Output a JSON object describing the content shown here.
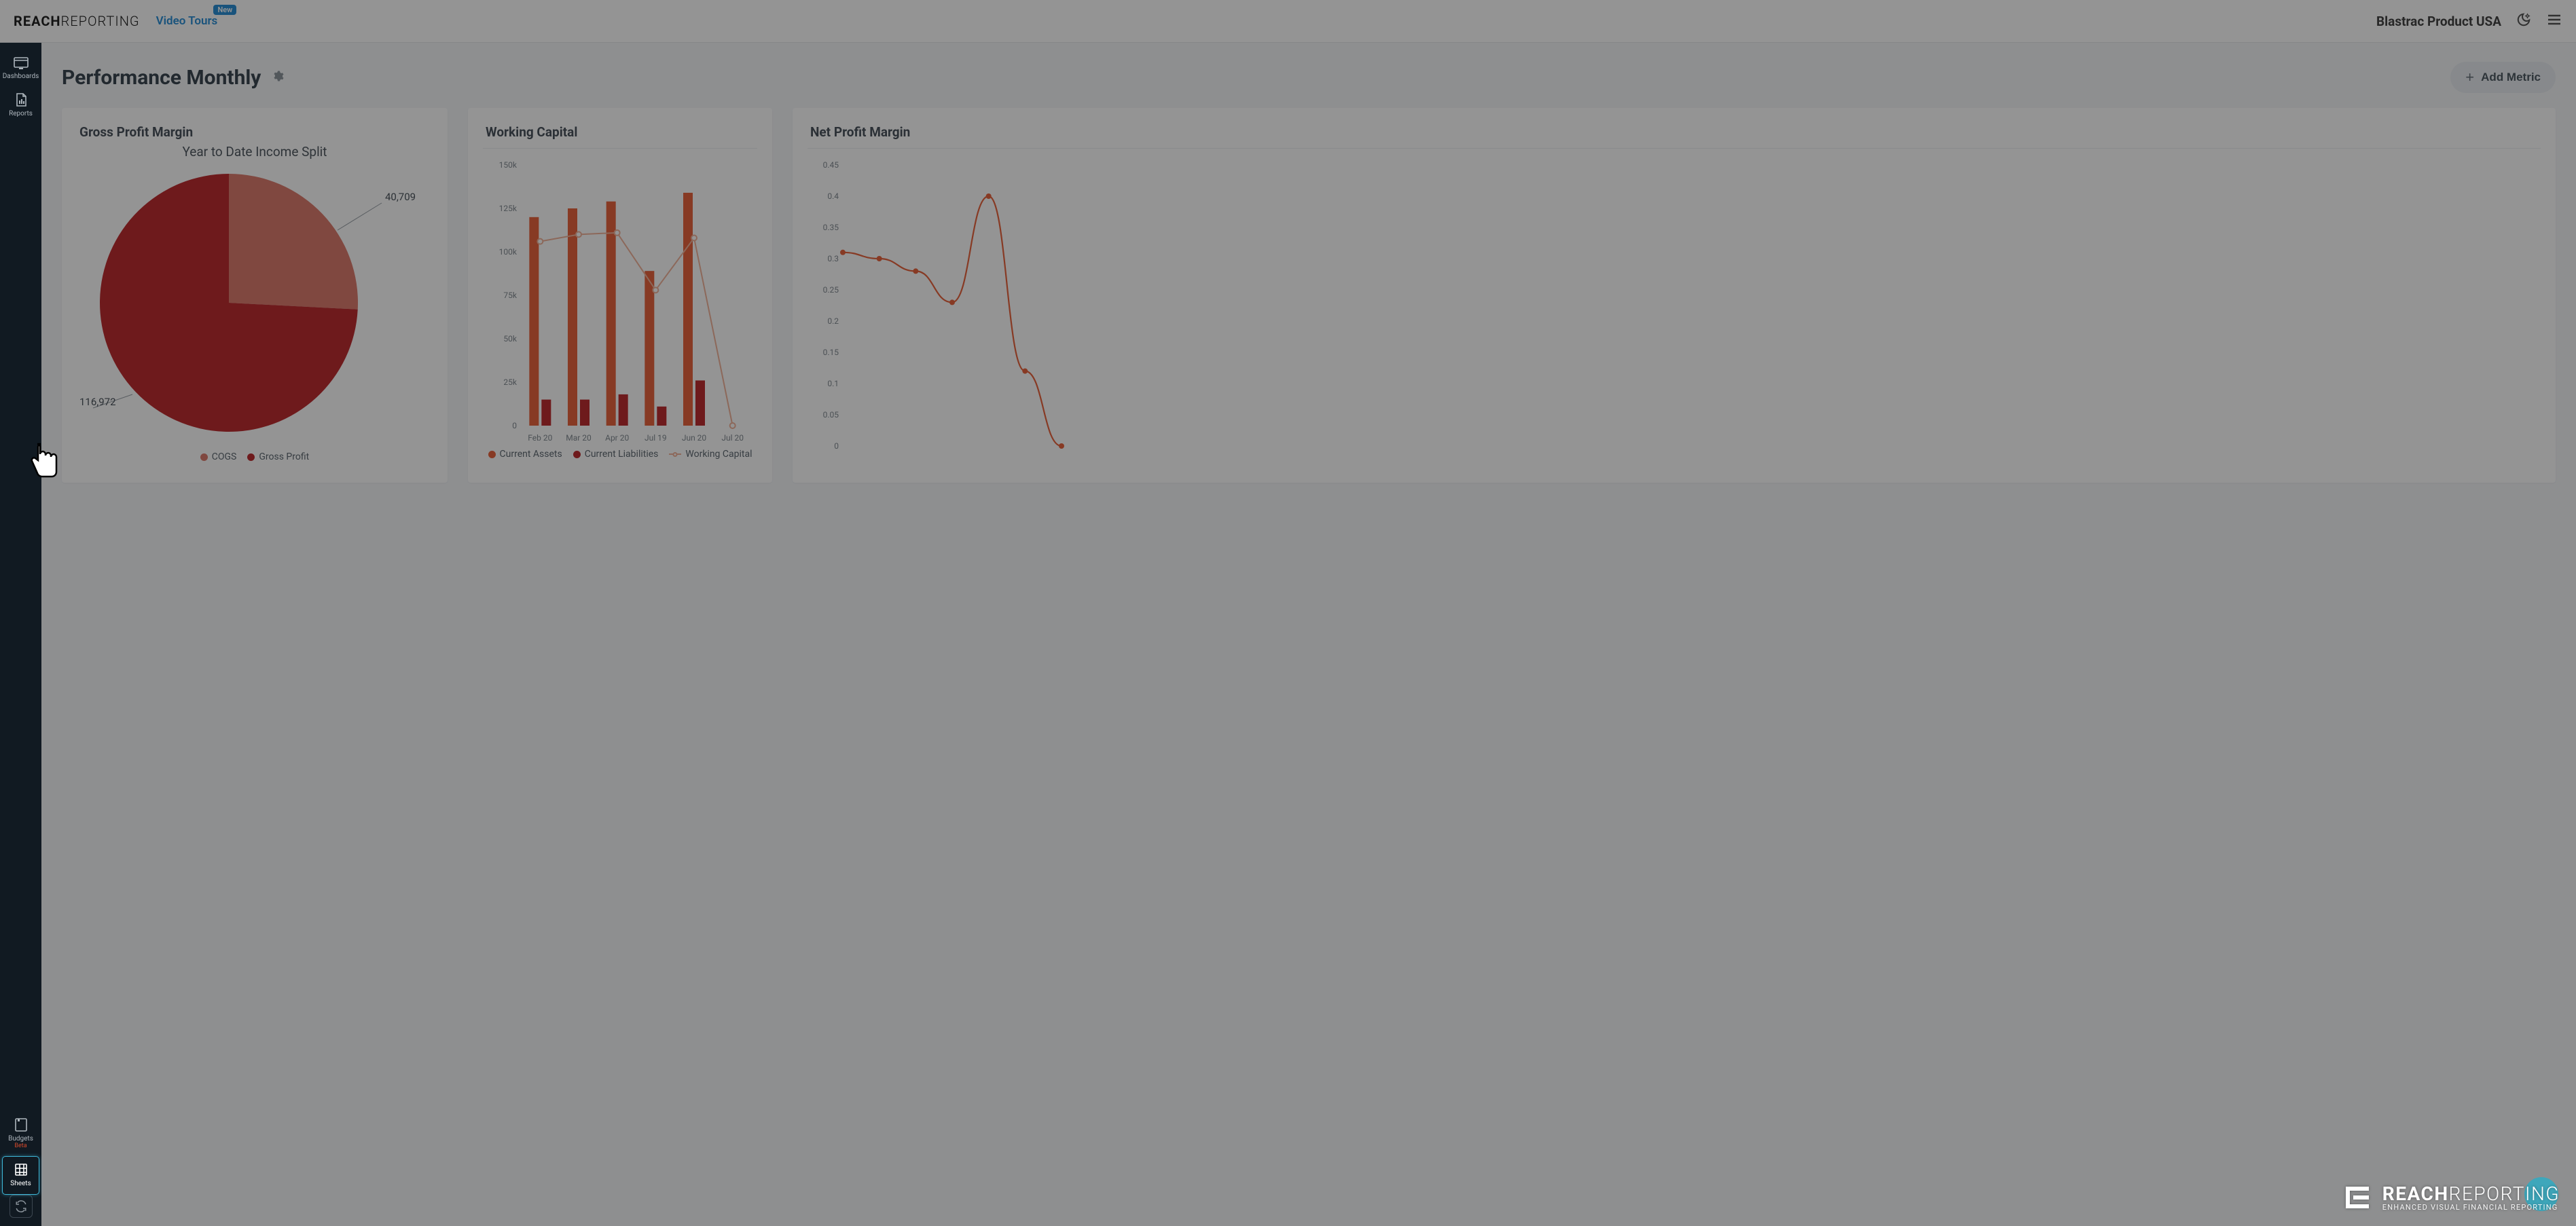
{
  "header": {
    "brand_bold": "REACH",
    "brand_light": "REPORTING",
    "video_tours": "Video Tours",
    "video_tours_badge": "New",
    "company": "Blastrac Product USA"
  },
  "sidebar": {
    "dashboards": "Dashboards",
    "reports": "Reports",
    "budgets": "Budgets",
    "budgets_beta": "Beta",
    "sheets": "Sheets"
  },
  "page": {
    "title": "Performance Monthly",
    "add_metric": "Add Metric"
  },
  "cards": {
    "gross_profit": {
      "title": "Gross Profit Margin",
      "subtitle": "Year to Date Income Split"
    },
    "working_capital": {
      "title": "Working Capital"
    },
    "net_profit": {
      "title": "Net Profit Margin"
    }
  },
  "watermark": {
    "main_bold": "REACH",
    "main_light": "REPORTING",
    "sub": "ENHANCED VISUAL FINANCIAL REPORTING"
  },
  "chart_data": [
    {
      "type": "pie",
      "title": "Year to Date Income Split",
      "series": [
        {
          "name": "COGS",
          "value": 40709,
          "color": "#dc7d6f"
        },
        {
          "name": "Gross Profit",
          "value": 116972,
          "color": "#be2e31"
        }
      ],
      "labels": [
        "40,709",
        "116,972"
      ]
    },
    {
      "type": "bar",
      "title": "Working Capital",
      "categories": [
        "Feb 20",
        "Mar 20",
        "Apr 20",
        "Jul 19",
        "Jun 20",
        "Jul 20"
      ],
      "ylim": [
        0,
        150000
      ],
      "yticks": [
        "0",
        "25k",
        "50k",
        "75k",
        "100k",
        "125k",
        "150k"
      ],
      "series": [
        {
          "name": "Current Assets",
          "color": "#e8653f",
          "values": [
            120000,
            125000,
            129000,
            89000,
            134000,
            0
          ]
        },
        {
          "name": "Current Liabilities",
          "color": "#be2e31",
          "values": [
            15000,
            15000,
            18000,
            11000,
            26000,
            0
          ]
        },
        {
          "name": "Working Capital",
          "type": "line",
          "color": "#f2b49b",
          "values": [
            106000,
            110000,
            111000,
            78000,
            108000,
            0
          ]
        }
      ]
    },
    {
      "type": "line",
      "title": "Net Profit Margin",
      "ylim": [
        0,
        0.45
      ],
      "yticks": [
        "0",
        "0.05",
        "0.1",
        "0.15",
        "0.2",
        "0.25",
        "0.3",
        "0.35",
        "0.4",
        "0.45"
      ],
      "x": [
        1,
        2,
        3,
        4,
        5,
        6,
        7
      ],
      "values": [
        0.31,
        0.3,
        0.28,
        0.23,
        0.4,
        0.12,
        0.0
      ],
      "color": "#e8653f"
    }
  ]
}
